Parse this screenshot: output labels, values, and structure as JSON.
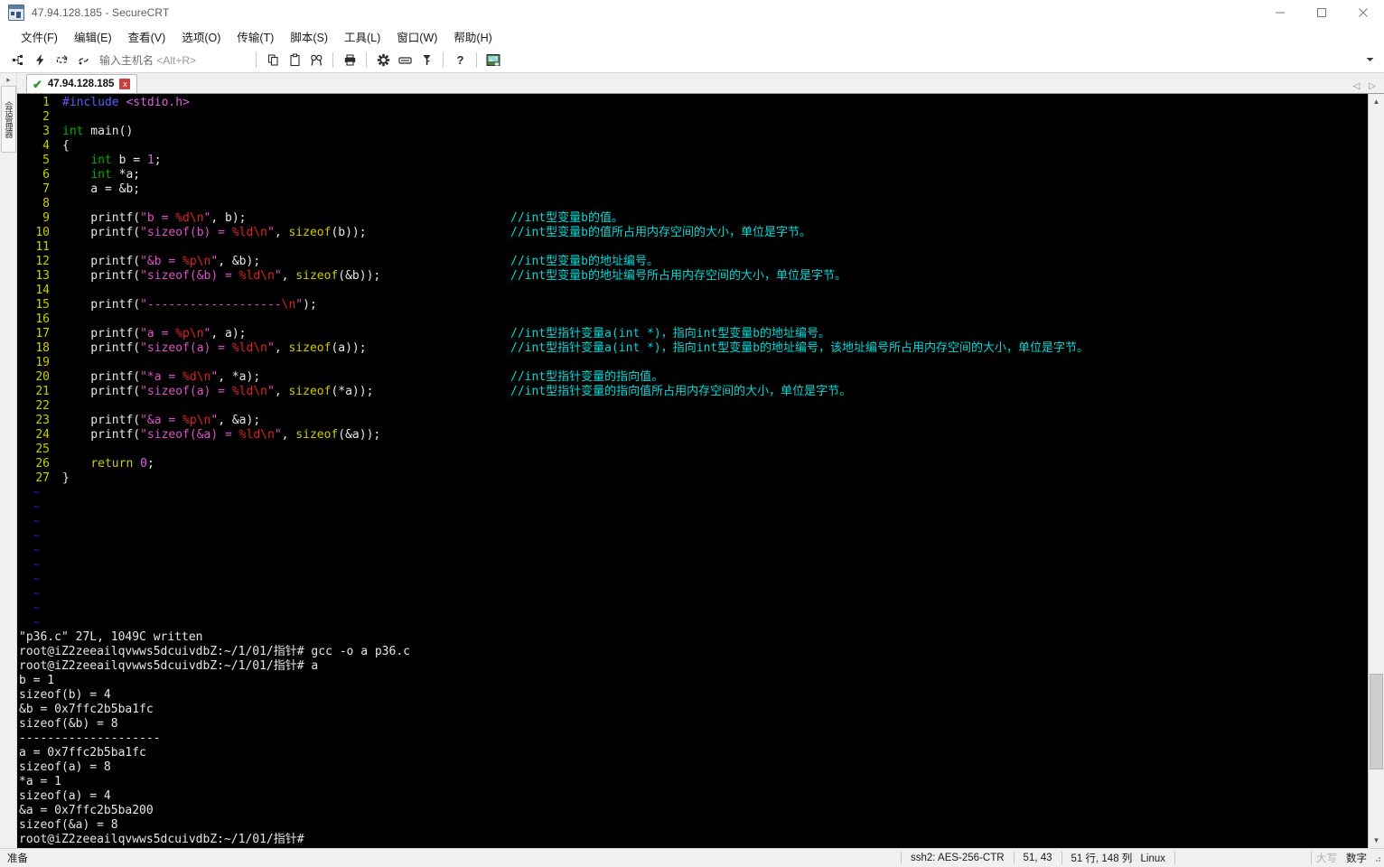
{
  "window": {
    "title": "47.94.128.185 - SecureCRT",
    "app_icon": "securecrt-icon",
    "minimize_label": "minimize",
    "maximize_label": "maximize",
    "close_label": "close"
  },
  "menu": {
    "items": [
      {
        "label": "文件(F)",
        "name": "menu-file"
      },
      {
        "label": "编辑(E)",
        "name": "menu-edit"
      },
      {
        "label": "查看(V)",
        "name": "menu-view"
      },
      {
        "label": "选项(O)",
        "name": "menu-options"
      },
      {
        "label": "传输(T)",
        "name": "menu-transfer"
      },
      {
        "label": "脚本(S)",
        "name": "menu-script"
      },
      {
        "label": "工具(L)",
        "name": "menu-tools"
      },
      {
        "label": "窗口(W)",
        "name": "menu-window"
      },
      {
        "label": "帮助(H)",
        "name": "menu-help"
      }
    ]
  },
  "toolbar": {
    "host_label": "输入主机名",
    "host_hint": "<Alt+R>",
    "icons": [
      "new-session-icon",
      "quick-connect-icon",
      "reconnect-icon",
      "clone-session-icon",
      "copy-icon",
      "paste-icon",
      "find-icon",
      "print-icon",
      "settings-icon",
      "keymap-icon",
      "key-icon",
      "help-icon",
      "chat-icon"
    ],
    "overflow_label": "toolbar-overflow"
  },
  "sidebar": {
    "tab_label": "会话管理器"
  },
  "session_tabs": {
    "tabs": [
      {
        "label": "47.94.128.185",
        "status": "connected",
        "close_label": "x"
      }
    ],
    "nav_prev": "◁",
    "nav_next": "▷"
  },
  "terminal": {
    "editor": {
      "lines": [
        {
          "n": "1",
          "tokens": [
            {
              "t": "#include",
              "c": "c-pre"
            },
            {
              "t": " ",
              "c": "c-plain"
            },
            {
              "t": "<stdio.h>",
              "c": "c-inc"
            }
          ]
        },
        {
          "n": "2",
          "tokens": []
        },
        {
          "n": "3",
          "tokens": [
            {
              "t": "int",
              "c": "c-type"
            },
            {
              "t": " main()",
              "c": "c-plain"
            }
          ]
        },
        {
          "n": "4",
          "tokens": [
            {
              "t": "{",
              "c": "c-plain"
            }
          ]
        },
        {
          "n": "5",
          "tokens": [
            {
              "t": "    ",
              "c": "c-plain"
            },
            {
              "t": "int",
              "c": "c-type"
            },
            {
              "t": " b = ",
              "c": "c-plain"
            },
            {
              "t": "1",
              "c": "c-num"
            },
            {
              "t": ";",
              "c": "c-plain"
            }
          ]
        },
        {
          "n": "6",
          "tokens": [
            {
              "t": "    ",
              "c": "c-plain"
            },
            {
              "t": "int",
              "c": "c-type"
            },
            {
              "t": " *a;",
              "c": "c-plain"
            }
          ]
        },
        {
          "n": "7",
          "tokens": [
            {
              "t": "    a = &b;",
              "c": "c-plain"
            }
          ]
        },
        {
          "n": "8",
          "tokens": []
        },
        {
          "n": "9",
          "tokens": [
            {
              "t": "    printf(",
              "c": "c-plain"
            },
            {
              "t": "\"b = ",
              "c": "c-str"
            },
            {
              "t": "%d",
              "c": "c-fmt"
            },
            {
              "t": "\\n",
              "c": "c-fmt"
            },
            {
              "t": "\"",
              "c": "c-str"
            },
            {
              "t": ", b);",
              "c": "c-plain"
            }
          ],
          "comment": "//int型变量b的值。"
        },
        {
          "n": "10",
          "tokens": [
            {
              "t": "    printf(",
              "c": "c-plain"
            },
            {
              "t": "\"sizeof(b) = ",
              "c": "c-str"
            },
            {
              "t": "%ld",
              "c": "c-fmt"
            },
            {
              "t": "\\n",
              "c": "c-fmt"
            },
            {
              "t": "\"",
              "c": "c-str"
            },
            {
              "t": ", ",
              "c": "c-plain"
            },
            {
              "t": "sizeof",
              "c": "c-kw"
            },
            {
              "t": "(b));",
              "c": "c-plain"
            }
          ],
          "comment": "//int型变量b的值所占用内存空间的大小，单位是字节。"
        },
        {
          "n": "11",
          "tokens": []
        },
        {
          "n": "12",
          "tokens": [
            {
              "t": "    printf(",
              "c": "c-plain"
            },
            {
              "t": "\"&b = ",
              "c": "c-str"
            },
            {
              "t": "%p",
              "c": "c-fmt"
            },
            {
              "t": "\\n",
              "c": "c-fmt"
            },
            {
              "t": "\"",
              "c": "c-str"
            },
            {
              "t": ", &b);",
              "c": "c-plain"
            }
          ],
          "comment": "//int型变量b的地址编号。"
        },
        {
          "n": "13",
          "tokens": [
            {
              "t": "    printf(",
              "c": "c-plain"
            },
            {
              "t": "\"sizeof(&b) = ",
              "c": "c-str"
            },
            {
              "t": "%ld",
              "c": "c-fmt"
            },
            {
              "t": "\\n",
              "c": "c-fmt"
            },
            {
              "t": "\"",
              "c": "c-str"
            },
            {
              "t": ", ",
              "c": "c-plain"
            },
            {
              "t": "sizeof",
              "c": "c-kw"
            },
            {
              "t": "(&b));",
              "c": "c-plain"
            }
          ],
          "comment": "//int型变量b的地址编号所占用内存空间的大小，单位是字节。"
        },
        {
          "n": "14",
          "tokens": []
        },
        {
          "n": "15",
          "tokens": [
            {
              "t": "    printf(",
              "c": "c-plain"
            },
            {
              "t": "\"-------------------",
              "c": "c-str"
            },
            {
              "t": "\\n",
              "c": "c-fmt"
            },
            {
              "t": "\"",
              "c": "c-str"
            },
            {
              "t": ");",
              "c": "c-plain"
            }
          ]
        },
        {
          "n": "16",
          "tokens": []
        },
        {
          "n": "17",
          "tokens": [
            {
              "t": "    printf(",
              "c": "c-plain"
            },
            {
              "t": "\"a = ",
              "c": "c-str"
            },
            {
              "t": "%p",
              "c": "c-fmt"
            },
            {
              "t": "\\n",
              "c": "c-fmt"
            },
            {
              "t": "\"",
              "c": "c-str"
            },
            {
              "t": ", a);",
              "c": "c-plain"
            }
          ],
          "comment": "//int型指针变量a(int *)，指向int型变量b的地址编号。"
        },
        {
          "n": "18",
          "tokens": [
            {
              "t": "    printf(",
              "c": "c-plain"
            },
            {
              "t": "\"sizeof(a) = ",
              "c": "c-str"
            },
            {
              "t": "%ld",
              "c": "c-fmt"
            },
            {
              "t": "\\n",
              "c": "c-fmt"
            },
            {
              "t": "\"",
              "c": "c-str"
            },
            {
              "t": ", ",
              "c": "c-plain"
            },
            {
              "t": "sizeof",
              "c": "c-kw"
            },
            {
              "t": "(a));",
              "c": "c-plain"
            }
          ],
          "comment": "//int型指针变量a(int *)，指向int型变量b的地址编号，该地址编号所占用内存空间的大小，单位是字节。"
        },
        {
          "n": "19",
          "tokens": []
        },
        {
          "n": "20",
          "tokens": [
            {
              "t": "    printf(",
              "c": "c-plain"
            },
            {
              "t": "\"*a = ",
              "c": "c-str"
            },
            {
              "t": "%d",
              "c": "c-fmt"
            },
            {
              "t": "\\n",
              "c": "c-fmt"
            },
            {
              "t": "\"",
              "c": "c-str"
            },
            {
              "t": ", *a);",
              "c": "c-plain"
            }
          ],
          "comment": "//int型指针变量的指向值。"
        },
        {
          "n": "21",
          "tokens": [
            {
              "t": "    printf(",
              "c": "c-plain"
            },
            {
              "t": "\"sizeof(a) = ",
              "c": "c-str"
            },
            {
              "t": "%ld",
              "c": "c-fmt"
            },
            {
              "t": "\\n",
              "c": "c-fmt"
            },
            {
              "t": "\"",
              "c": "c-str"
            },
            {
              "t": ", ",
              "c": "c-plain"
            },
            {
              "t": "sizeof",
              "c": "c-kw"
            },
            {
              "t": "(*a));",
              "c": "c-plain"
            }
          ],
          "comment": "//int型指针变量的指向值所占用内存空间的大小，单位是字节。"
        },
        {
          "n": "22",
          "tokens": []
        },
        {
          "n": "23",
          "tokens": [
            {
              "t": "    printf(",
              "c": "c-plain"
            },
            {
              "t": "\"&a = ",
              "c": "c-str"
            },
            {
              "t": "%p",
              "c": "c-fmt"
            },
            {
              "t": "\\n",
              "c": "c-fmt"
            },
            {
              "t": "\"",
              "c": "c-str"
            },
            {
              "t": ", &a);",
              "c": "c-plain"
            }
          ]
        },
        {
          "n": "24",
          "tokens": [
            {
              "t": "    printf(",
              "c": "c-plain"
            },
            {
              "t": "\"sizeof(&a) = ",
              "c": "c-str"
            },
            {
              "t": "%ld",
              "c": "c-fmt"
            },
            {
              "t": "\\n",
              "c": "c-fmt"
            },
            {
              "t": "\"",
              "c": "c-str"
            },
            {
              "t": ", ",
              "c": "c-plain"
            },
            {
              "t": "sizeof",
              "c": "c-kw"
            },
            {
              "t": "(&a));",
              "c": "c-plain"
            }
          ]
        },
        {
          "n": "25",
          "tokens": []
        },
        {
          "n": "26",
          "tokens": [
            {
              "t": "    ",
              "c": "c-plain"
            },
            {
              "t": "return",
              "c": "c-kw"
            },
            {
              "t": " ",
              "c": "c-plain"
            },
            {
              "t": "0",
              "c": "c-num"
            },
            {
              "t": ";",
              "c": "c-plain"
            }
          ]
        },
        {
          "n": "27",
          "tokens": [
            {
              "t": "}",
              "c": "c-plain"
            }
          ]
        }
      ],
      "empty_marker": "~",
      "empty_count": 10
    },
    "output": [
      "\"p36.c\" 27L, 1049C written",
      "root@iZ2zeeailqvwws5dcuivdbZ:~/1/01/指针# gcc -o a p36.c",
      "root@iZ2zeeailqvwws5dcuivdbZ:~/1/01/指针# a",
      "b = 1",
      "sizeof(b) = 4",
      "&b = 0x7ffc2b5ba1fc",
      "sizeof(&b) = 8",
      "--------------------",
      "a = 0x7ffc2b5ba1fc",
      "sizeof(a) = 8",
      "*a = 1",
      "sizeof(a) = 4",
      "&a = 0x7ffc2b5ba200",
      "sizeof(&a) = 8",
      "root@iZ2zeeailqvwws5dcuivdbZ:~/1/01/指针#"
    ]
  },
  "scrollbar": {
    "up_arrow": "▲",
    "down_arrow": "▼"
  },
  "statusbar": {
    "ready": "准备",
    "encryption": "ssh2: AES-256-CTR",
    "cursor": "51, 43",
    "size": "51 行, 148 列",
    "protocol": "Linux",
    "caps": "大写",
    "num": "数字"
  },
  "colors": {
    "accent_green": "#2a9c2a",
    "close_red": "#c7433f",
    "terminal_bg": "#000000",
    "comment_cyan": "#00d8d8",
    "string_magenta": "#e050c8",
    "format_red": "#e02020",
    "keyword_yellow": "#cccc00",
    "type_green": "#00b000",
    "linenum_yellow": "#cccc00"
  }
}
